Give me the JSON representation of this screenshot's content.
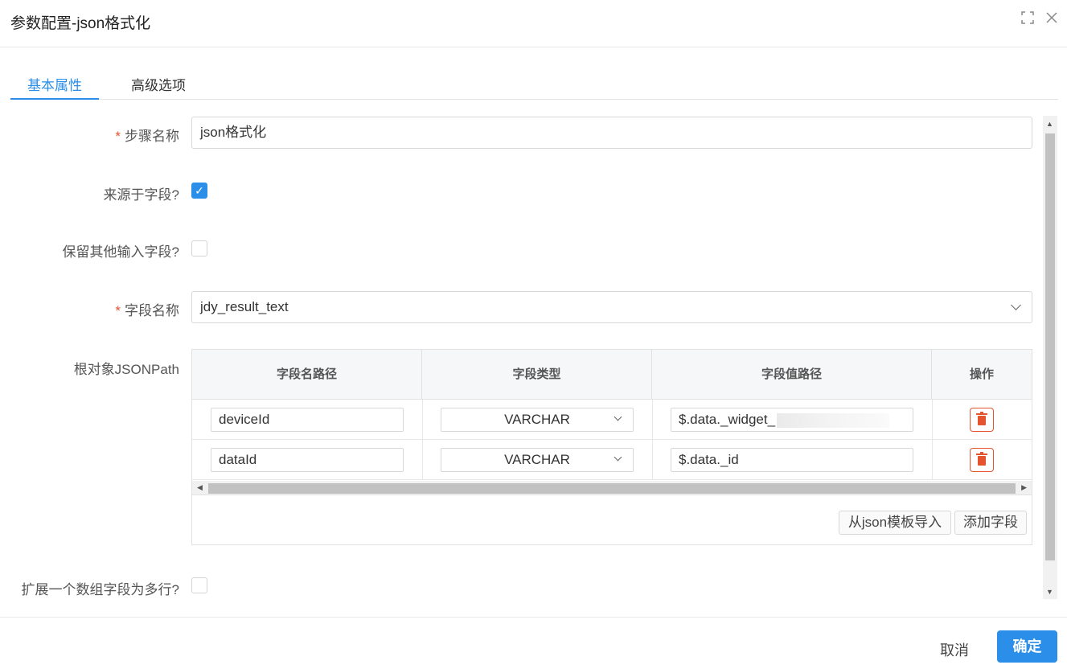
{
  "dialog": {
    "title": "参数配置-json格式化",
    "maximize_icon": "maximize-icon",
    "close_icon": "close-icon"
  },
  "tabs": [
    {
      "label": "基本属性",
      "active": true
    },
    {
      "label": "高级选项",
      "active": false
    }
  ],
  "form": {
    "step_name": {
      "label": "步骤名称",
      "required": true,
      "value": "json格式化"
    },
    "from_field": {
      "label": "来源于字段?",
      "checked": true
    },
    "keep_other_fields": {
      "label": "保留其他输入字段?",
      "checked": false
    },
    "field_name": {
      "label": "字段名称",
      "required": true,
      "value": "jdy_result_text"
    },
    "root_jsonpath": {
      "label": "根对象JSONPath"
    },
    "expand_array": {
      "label": "扩展一个数组字段为多行?",
      "checked": false
    }
  },
  "table": {
    "columns": [
      "字段名路径",
      "字段类型",
      "字段值路径",
      "操作"
    ],
    "rows": [
      {
        "name_path": "deviceId",
        "type": "VARCHAR",
        "value_path": "$.data._widget_"
      },
      {
        "name_path": "dataId",
        "type": "VARCHAR",
        "value_path": "$.data._id"
      }
    ],
    "import_button": "从json模板导入",
    "add_field_button": "添加字段"
  },
  "footer": {
    "cancel": "取消",
    "confirm": "确定"
  },
  "colors": {
    "accent": "#2b8ee8",
    "danger": "#e4542f"
  }
}
